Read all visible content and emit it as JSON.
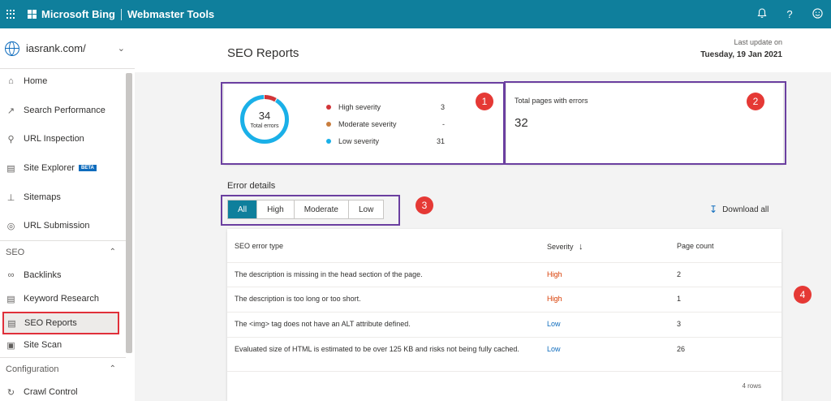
{
  "topbar": {
    "brand": "Microsoft Bing",
    "product": "Webmaster Tools"
  },
  "sidebar": {
    "site": "iasrank.com/",
    "items": [
      {
        "label": "Home",
        "icon": "home-icon"
      },
      {
        "label": "Search Performance",
        "icon": "trend-icon"
      },
      {
        "label": "URL Inspection",
        "icon": "search-icon"
      },
      {
        "label": "Site Explorer",
        "icon": "document-icon",
        "badge": "BETA"
      },
      {
        "label": "Sitemaps",
        "icon": "sitemap-icon"
      },
      {
        "label": "URL Submission",
        "icon": "globe-icon"
      }
    ],
    "seo_section": "SEO",
    "seo_items": [
      {
        "label": "Backlinks",
        "icon": "link-icon"
      },
      {
        "label": "Keyword Research",
        "icon": "document-icon"
      },
      {
        "label": "SEO Reports",
        "icon": "report-icon",
        "active": true
      },
      {
        "label": "Site Scan",
        "icon": "scan-icon"
      }
    ],
    "config_section": "Configuration",
    "config_items": [
      {
        "label": "Crawl Control",
        "icon": "crawl-icon"
      }
    ]
  },
  "header": {
    "title": "SEO Reports",
    "last_update_label": "Last update on",
    "last_update_date": "Tuesday, 19 Jan 2021"
  },
  "summary": {
    "total_errors": "34",
    "total_errors_label": "Total errors",
    "legend": [
      {
        "label": "High severity",
        "value": "3",
        "color": "#d13438",
        "count": 3
      },
      {
        "label": "Moderate severity",
        "value": "-",
        "color": "#c87d3e",
        "count": 0
      },
      {
        "label": "Low severity",
        "value": "31",
        "color": "#1ab0e8",
        "count": 31
      }
    ],
    "badge": "1"
  },
  "pages_card": {
    "label": "Total pages with errors",
    "value": "32",
    "badge": "2"
  },
  "error_details": {
    "title": "Error details",
    "filters": [
      "All",
      "High",
      "Moderate",
      "Low"
    ],
    "selected_filter": "All",
    "badge": "3",
    "download_label": "Download all"
  },
  "table": {
    "badge": "4",
    "headers": {
      "type": "SEO error type",
      "severity": "Severity",
      "count": "Page count"
    },
    "rows": [
      {
        "type": "The description is missing in the head section of the page.",
        "severity": "High",
        "count": "2"
      },
      {
        "type": "The description is too long or too short.",
        "severity": "High",
        "count": "1"
      },
      {
        "type": "The <img> tag does not have an ALT attribute defined.",
        "severity": "Low",
        "count": "3"
      },
      {
        "type": "Evaluated size of HTML is estimated to be over 125 KB and risks not being fully cached.",
        "severity": "Low",
        "count": "26"
      }
    ],
    "rows_note": "4 rows"
  },
  "colors": {
    "topbar": "#0f7f9c",
    "highlight": "#6b3fa0",
    "badge": "#e53935",
    "active_outline": "#e0303a"
  }
}
